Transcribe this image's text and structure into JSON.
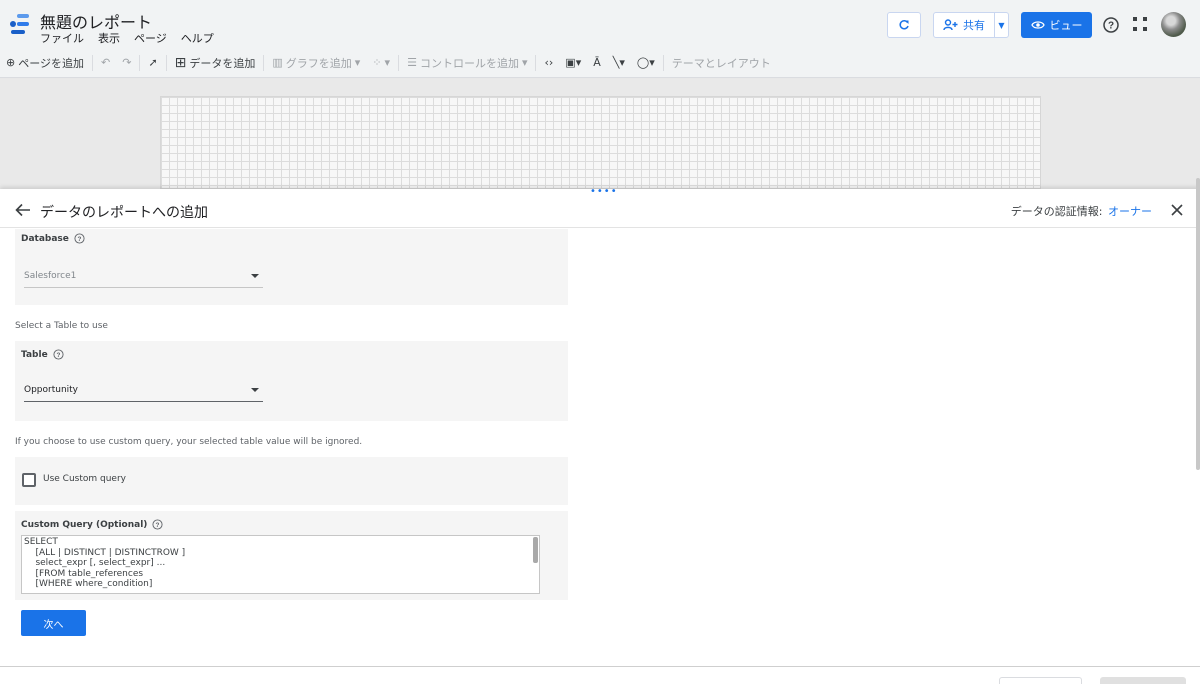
{
  "header": {
    "doc_title": "無題のレポート",
    "menu": [
      "ファイル",
      "表示",
      "ページ",
      "ヘルプ"
    ],
    "share_label": "共有",
    "view_label": "ビュー",
    "accent": "#1a73e8"
  },
  "toolbar": {
    "add_page": "ページを追加",
    "add_data": "データを追加",
    "add_chart": "グラフを追加",
    "add_control": "コントロールを追加",
    "theme_layout": "テーマとレイアウト"
  },
  "panel": {
    "title": "データのレポートへの追加",
    "credentials_label": "データの認証情報:",
    "credentials_value": "オーナー",
    "database": {
      "label": "Database",
      "value": "Salesforce1"
    },
    "table_note": "Select a Table to use",
    "table": {
      "label": "Table",
      "value": "Opportunity"
    },
    "custom_note": "If you choose to use custom query, your selected table value will be ignored.",
    "use_custom_label": "Use Custom query",
    "custom_query": {
      "label": "Custom Query (Optional)",
      "lines": [
        "SELECT",
        "    [ALL | DISTINCT | DISTINCTROW ]",
        "    select_expr [, select_expr] ...",
        "    [FROM table_references",
        "    [WHERE where_condition]"
      ]
    },
    "next_label": "次へ"
  }
}
